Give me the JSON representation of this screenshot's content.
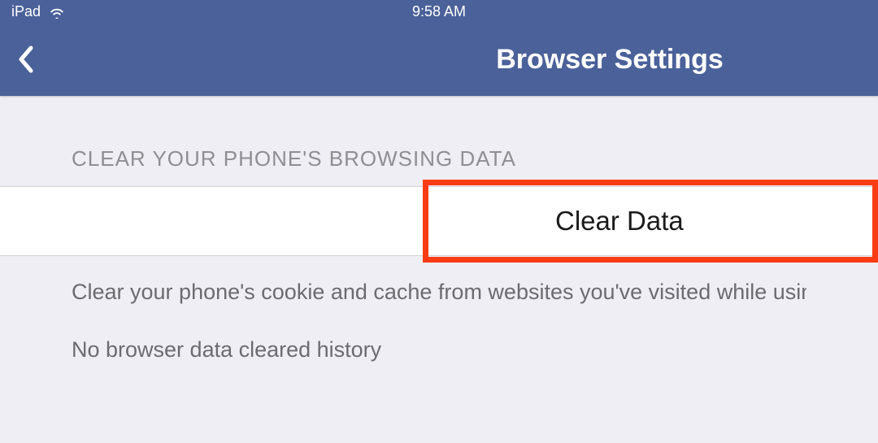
{
  "status_bar": {
    "device": "iPad",
    "time": "9:58 AM"
  },
  "nav": {
    "title": "Browser Settings"
  },
  "section": {
    "header": "CLEAR YOUR PHONE'S BROWSING DATA",
    "clear_button": "Clear Data",
    "description_line1": "Clear your phone's cookie and cache from websites you've visited while using the",
    "description_line2": "No browser data cleared history"
  },
  "colors": {
    "header_bg": "#4b6199",
    "highlight_border": "#fa3c14",
    "page_bg": "#efeef4"
  }
}
